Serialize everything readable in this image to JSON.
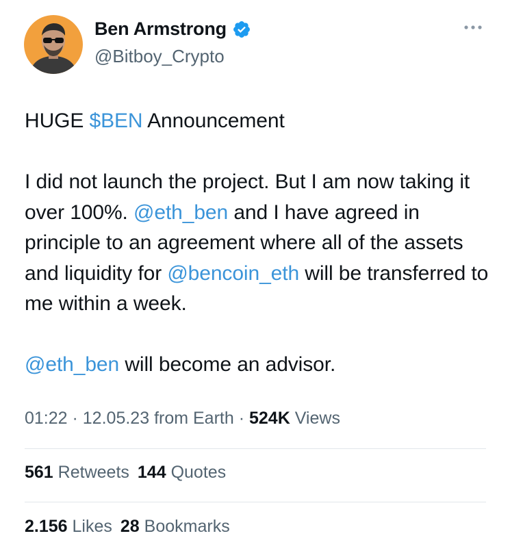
{
  "author": {
    "display_name": "Ben Armstrong",
    "handle": "@Bitboy_Crypto",
    "verified": true,
    "avatar_bg_color": "#f2a03d"
  },
  "tweet": {
    "line1_prefix": "HUGE ",
    "line1_cashtag": "$BEN",
    "line1_suffix": " Announcement",
    "para2_part1": "I did not launch the project. But I am now taking it over 100%. ",
    "para2_mention1": "@eth_ben",
    "para2_part2": " and I have agreed in principle to an agreement where all of the assets and liquidity for ",
    "para2_mention2": "@bencoin_eth",
    "para2_part3": " will be transferred to me within a week.",
    "para3_mention": "@eth_ben",
    "para3_rest": " will become an advisor."
  },
  "meta": {
    "time": "01:22",
    "separator": " · ",
    "date": "12.05.23",
    "source": "from Earth",
    "views_count": "524K",
    "views_label": "Views"
  },
  "stats": {
    "retweets_count": "561",
    "retweets_label": "Retweets",
    "quotes_count": "144",
    "quotes_label": "Quotes",
    "likes_count": "2.156",
    "likes_label": "Likes",
    "bookmarks_count": "28",
    "bookmarks_label": "Bookmarks"
  },
  "colors": {
    "link": "#3b94d9",
    "verified_badge": "#1d9bf0",
    "text_primary": "#0f1419",
    "text_secondary": "#536471"
  },
  "icons": {
    "verified": "verified-badge-icon",
    "more": "more-dots-icon"
  }
}
